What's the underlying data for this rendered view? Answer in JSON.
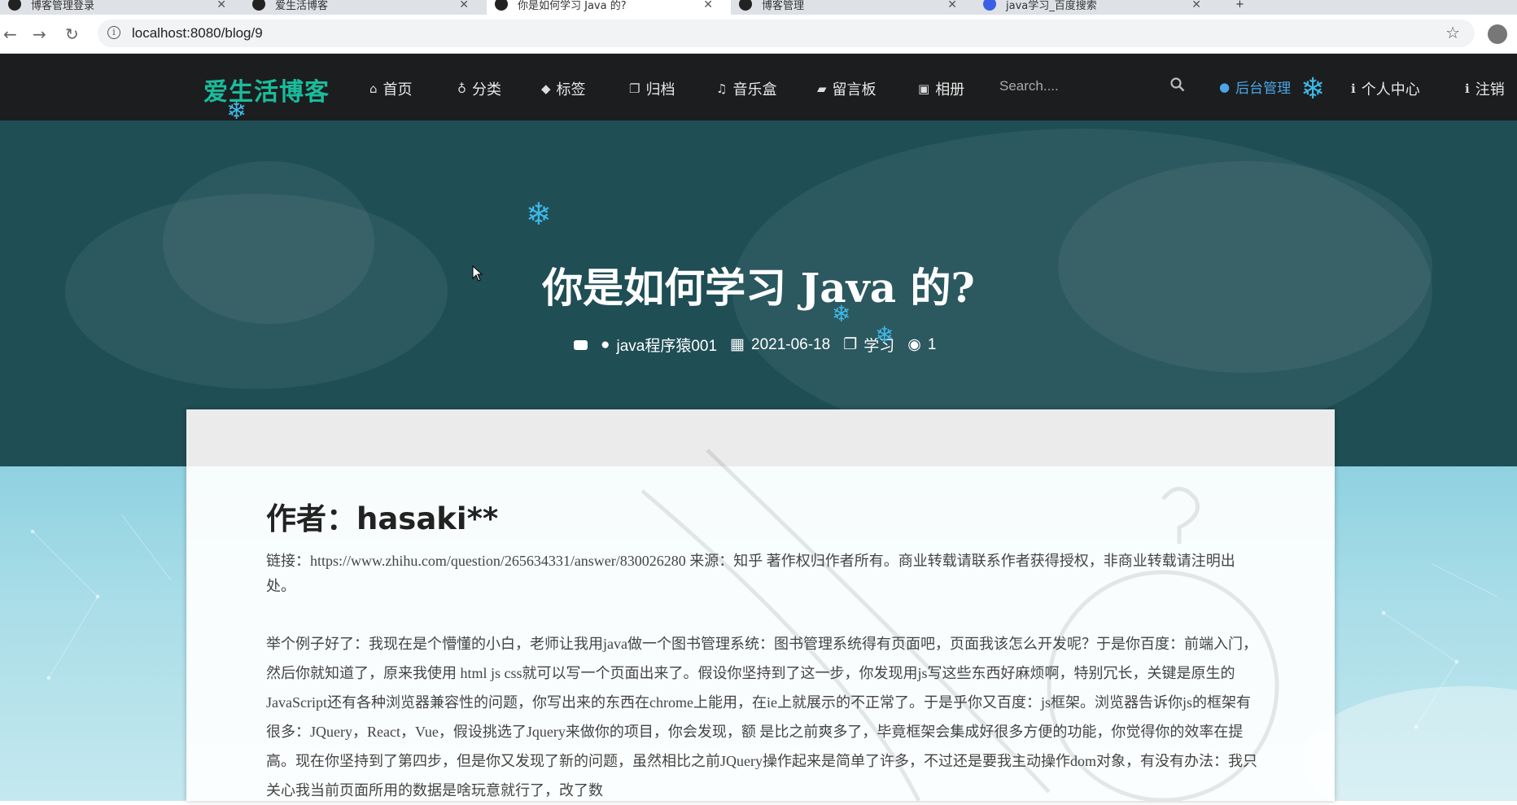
{
  "browser": {
    "tabs": [
      {
        "title": "博客管理登录"
      },
      {
        "title": "爱生活博客"
      },
      {
        "title": "你是如何学习 Java 的?"
      },
      {
        "title": "博客管理"
      },
      {
        "title": "java学习_百度搜索"
      }
    ],
    "url": "localhost:8080/blog/9"
  },
  "nav": {
    "logo": "爱生活博客",
    "items": [
      {
        "label": "首页",
        "icon": "home-icon"
      },
      {
        "label": "分类",
        "icon": "map-marker-icon"
      },
      {
        "label": "标签",
        "icon": "tags-icon"
      },
      {
        "label": "归档",
        "icon": "clone-icon"
      },
      {
        "label": "音乐盒",
        "icon": "music-icon"
      },
      {
        "label": "留言板",
        "icon": "book-icon"
      },
      {
        "label": "相册",
        "icon": "image-icon"
      }
    ],
    "search_placeholder": "Search....",
    "admin": "后台管理",
    "profile": "个人中心",
    "logout": "注销"
  },
  "post": {
    "title": "你是如何学习 Java 的?",
    "author": "java程序猿001",
    "date": "2021-06-18",
    "category": "学习",
    "views": "1",
    "heading": "作者：hasaki**",
    "para1": "链接：https://www.zhihu.com/question/265634331/answer/830026280 来源：知乎 著作权归作者所有。商业转载请联系作者获得授权，非商业转载请注明出处。",
    "para2": "举个例子好了：我现在是个懵懂的小白，老师让我用java做一个图书管理系统：图书管理系统得有页面吧，页面我该怎么开发呢？于是你百度：前端入门，然后你就知道了，原来我使用 html js css就可以写一个页面出来了。假设你坚持到了这一步，你发现用js写这些东西好麻烦啊，特别冗长，关键是原生的JavaScript还有各种浏览器兼容性的问题，你写出来的东西在chrome上能用，在ie上就展示的不正常了。于是乎你又百度：js框架。浏览器告诉你js的框架有很多：JQuery，React，Vue，假设挑选了Jquery来做你的项目，你会发现，额 是比之前爽多了，毕竟框架会集成好很多方便的功能，你觉得你的效率在提高。现在你坚持到了第四步，但是你又发现了新的问题，虽然相比之前JQuery操作起来是简单了许多，不过还是要我主动操作dom对象，有没有办法：我只关心我当前页面所用的数据是啥玩意就行了，改了数"
  },
  "colors": {
    "accent": "#1abc9c",
    "admin": "#4aa6e8",
    "hero": "#1f4e55",
    "nav": "#1c1d1e"
  }
}
